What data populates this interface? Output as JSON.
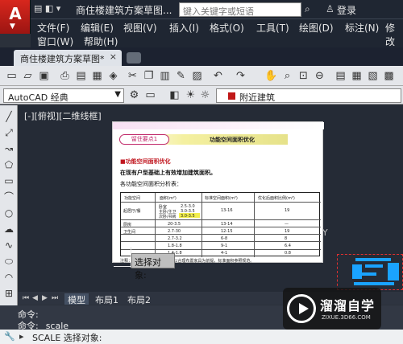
{
  "titlebar": {
    "title": "商住楼建筑方案草图...",
    "search_placeholder": "键入关键字或短语",
    "login": "登录",
    "qat_icons": "▤ ◧ ▾"
  },
  "menu": [
    "文件(F)",
    "编辑(E)",
    "视图(V)",
    "插入(I)",
    "格式(O)",
    "工具(T)",
    "绘图(D)",
    "标注(N)",
    "修改",
    "窗口(W)",
    "帮助(H)"
  ],
  "tabs": {
    "active": "商住楼建筑方案草图*",
    "close": "×"
  },
  "toolbar": {
    "workspace": "AutoCAD 经典",
    "layer": "附近建筑"
  },
  "viewport_label": "[-][俯视][二维线框]",
  "paper": {
    "badge": "留住要点1",
    "heading": "功能空间面积优化",
    "line1": "■功能空间面积优化",
    "line2": "在现有户型基础上有效增加建筑面积。",
    "line3": "各功能空间面积分析表：",
    "table_headers": [
      "功能空间",
      "面积(m²)",
      "标准空间面积(m²)",
      "优化后面积比例(m²)"
    ],
    "row_labels": [
      "起居厅/餐",
      "卧室",
      "主卧/主卫",
      "次卧/书房",
      "厨房",
      "卫生间"
    ],
    "table_values": [
      "2.5-3.0",
      "3.0-3.5",
      "3.0-3.5",
      "13-16",
      "19",
      "20-3.5",
      "13-14",
      "—",
      "2.7-30",
      "12-15",
      "19",
      "2.7-3.2",
      "6-8",
      "8",
      "1.8-1.8",
      "9-1",
      "6.4",
      "1.4-1.8",
      "4-1",
      "0.8"
    ],
    "footnote": "注释：1. 功能空间面积的计算以合理布置家具为前提，标准面积参照规范。"
  },
  "tooltip": "选择对象:",
  "coord_label": "Y",
  "model_tabs": [
    "模型",
    "布局1",
    "布局2"
  ],
  "command": {
    "line1": "命令:",
    "line2": "命令:  _scale",
    "input": "SCALE 选择对象:"
  },
  "watermark": {
    "title": "溜溜自学",
    "subtitle": "ZIXUE.3D66.COM"
  },
  "colors": {
    "app_red": "#c41c15",
    "cad_background": "#252b36",
    "selection_blue": "#1aa3ff"
  },
  "icons": [
    "new-file-icon",
    "open-folder-icon",
    "save-icon",
    "print-icon",
    "cut-icon",
    "copy-icon",
    "paste-icon",
    "undo-icon",
    "redo-icon",
    "pan-icon",
    "zoom-icon",
    "layer-icon",
    "line-tool-icon",
    "polyline-tool-icon",
    "circle-tool-icon",
    "arc-tool-icon",
    "rectangle-tool-icon",
    "hatch-tool-icon"
  ]
}
